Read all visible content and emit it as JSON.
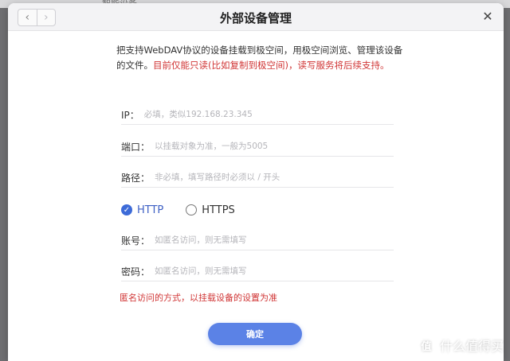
{
  "background": {
    "text": "智能设备"
  },
  "dialog": {
    "title": "外部设备管理",
    "nav": {
      "back": "‹",
      "forward": "›"
    },
    "close": "✕",
    "description": "把支持WebDAV协议的设备挂载到极空间，用极空间浏览、管理该设备的文件。",
    "warning": "目前仅能只读(比如复制到极空间)，读写服务将后续支持。",
    "fields": {
      "ip": {
        "label": "IP：",
        "placeholder": "必填，类似192.168.23.345"
      },
      "port": {
        "label": "端口：",
        "placeholder": "以挂载对象为准，一般为5005"
      },
      "path": {
        "label": "路径：",
        "placeholder": "非必填，填写路径时必须以 / 开头"
      },
      "account": {
        "label": "账号：",
        "placeholder": "如匿名访问，则无需填写"
      },
      "password": {
        "label": "密码：",
        "placeholder": "如匿名访问，则无需填写"
      }
    },
    "protocols": {
      "http": "HTTP",
      "https": "HTTPS",
      "selected": "HTTP"
    },
    "note": "匿名访问的方式，以挂载设备的设置为准",
    "confirm": "确定"
  },
  "watermark": {
    "logo": "值",
    "text": "什么值得买"
  },
  "colors": {
    "accent": "#5b82e6",
    "warning": "#d03535"
  }
}
